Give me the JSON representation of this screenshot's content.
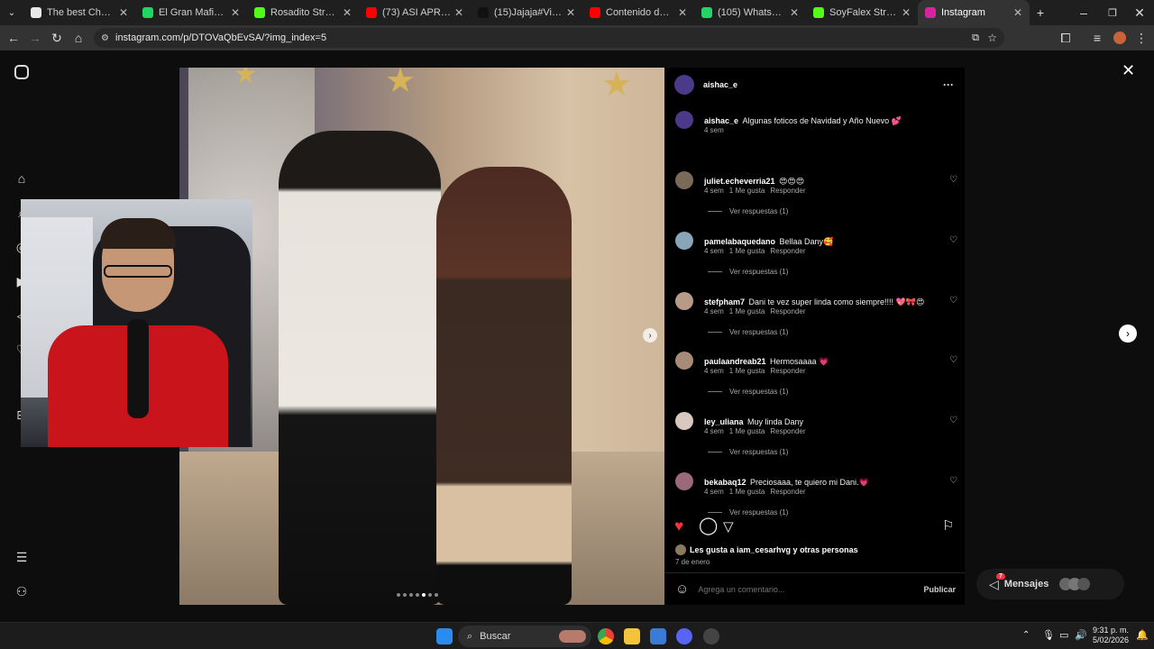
{
  "browser": {
    "tabs": [
      {
        "label": "The best ChatBot and",
        "color": "#e8e8e8"
      },
      {
        "label": "El Gran Mafioso -",
        "color": "#1ed760"
      },
      {
        "label": "Rosadito Stream - W",
        "color": "#53fc18"
      },
      {
        "label": "(73) ASI APRENDI A",
        "color": "#ff0000"
      },
      {
        "label": "(15)Jajaja#Viral #cole",
        "color": "#111111"
      },
      {
        "label": "Contenido del canal",
        "color": "#ff0000"
      },
      {
        "label": "(105) WhatsApp",
        "color": "#25d366"
      },
      {
        "label": "SoyFalex Stream - W",
        "color": "#53fc18"
      },
      {
        "label": "Instagram",
        "color": "#d6249f"
      }
    ],
    "new_tab": "+",
    "url": "instagram.com/p/DTOVaQbEvSA/?img_index=5"
  },
  "post": {
    "author": "aishac_e",
    "caption": "Algunas foticos de Navidad y Año Nuevo 💕",
    "caption_time": "4 sem",
    "comments": [
      {
        "user": "juliet.echeverria21",
        "text": "😍😍😍",
        "time": "4 sem",
        "likes": "1 Me gusta",
        "reply": "Responder",
        "replies": "Ver respuestas (1)",
        "avatar_color": "#7a6a58"
      },
      {
        "user": "pamelabaquedano",
        "text": "Bellaa Dany🥰",
        "time": "4 sem",
        "likes": "1 Me gusta",
        "reply": "Responder",
        "replies": "Ver respuestas (1)",
        "avatar_color": "#8aa4b8"
      },
      {
        "user": "stefpham7",
        "text": "Dani te vez super linda como siempre!!!! 💖🎀😍",
        "time": "4 sem",
        "likes": "1 Me gusta",
        "reply": "Responder",
        "replies": "Ver respuestas (1)",
        "avatar_color": "#b89a88"
      },
      {
        "user": "paulaandreab21",
        "text": "Hermosaaaa 💗",
        "time": "4 sem",
        "likes": "1 Me gusta",
        "reply": "Responder",
        "replies": "Ver respuestas (1)",
        "avatar_color": "#a88a78"
      },
      {
        "user": "ley_uliana",
        "text": "Muy linda Dany",
        "time": "4 sem",
        "likes": "1 Me gusta",
        "reply": "Responder",
        "replies": "Ver respuestas (1)",
        "avatar_color": "#d8c8c0"
      },
      {
        "user": "bekabaq12",
        "text": "Preciosaaa, te quiero mi Dani.💗",
        "time": "4 sem",
        "likes": "1 Me gusta",
        "reply": "Responder",
        "replies": "Ver respuestas (1)",
        "avatar_color": "#9a6a78"
      }
    ],
    "likes_text": "Les gusta a iam_cesarhvg y otras personas",
    "date": "7 de enero",
    "comment_placeholder": "Agrega un comentario...",
    "publish": "Publicar",
    "more": "···",
    "photo_count": 7,
    "photo_index": 5
  },
  "messages_label": "Mensajes",
  "messages_badge": "7",
  "taskbar": {
    "search": "Buscar",
    "time": "9:31 p. m.",
    "date": "5/02/2026"
  }
}
